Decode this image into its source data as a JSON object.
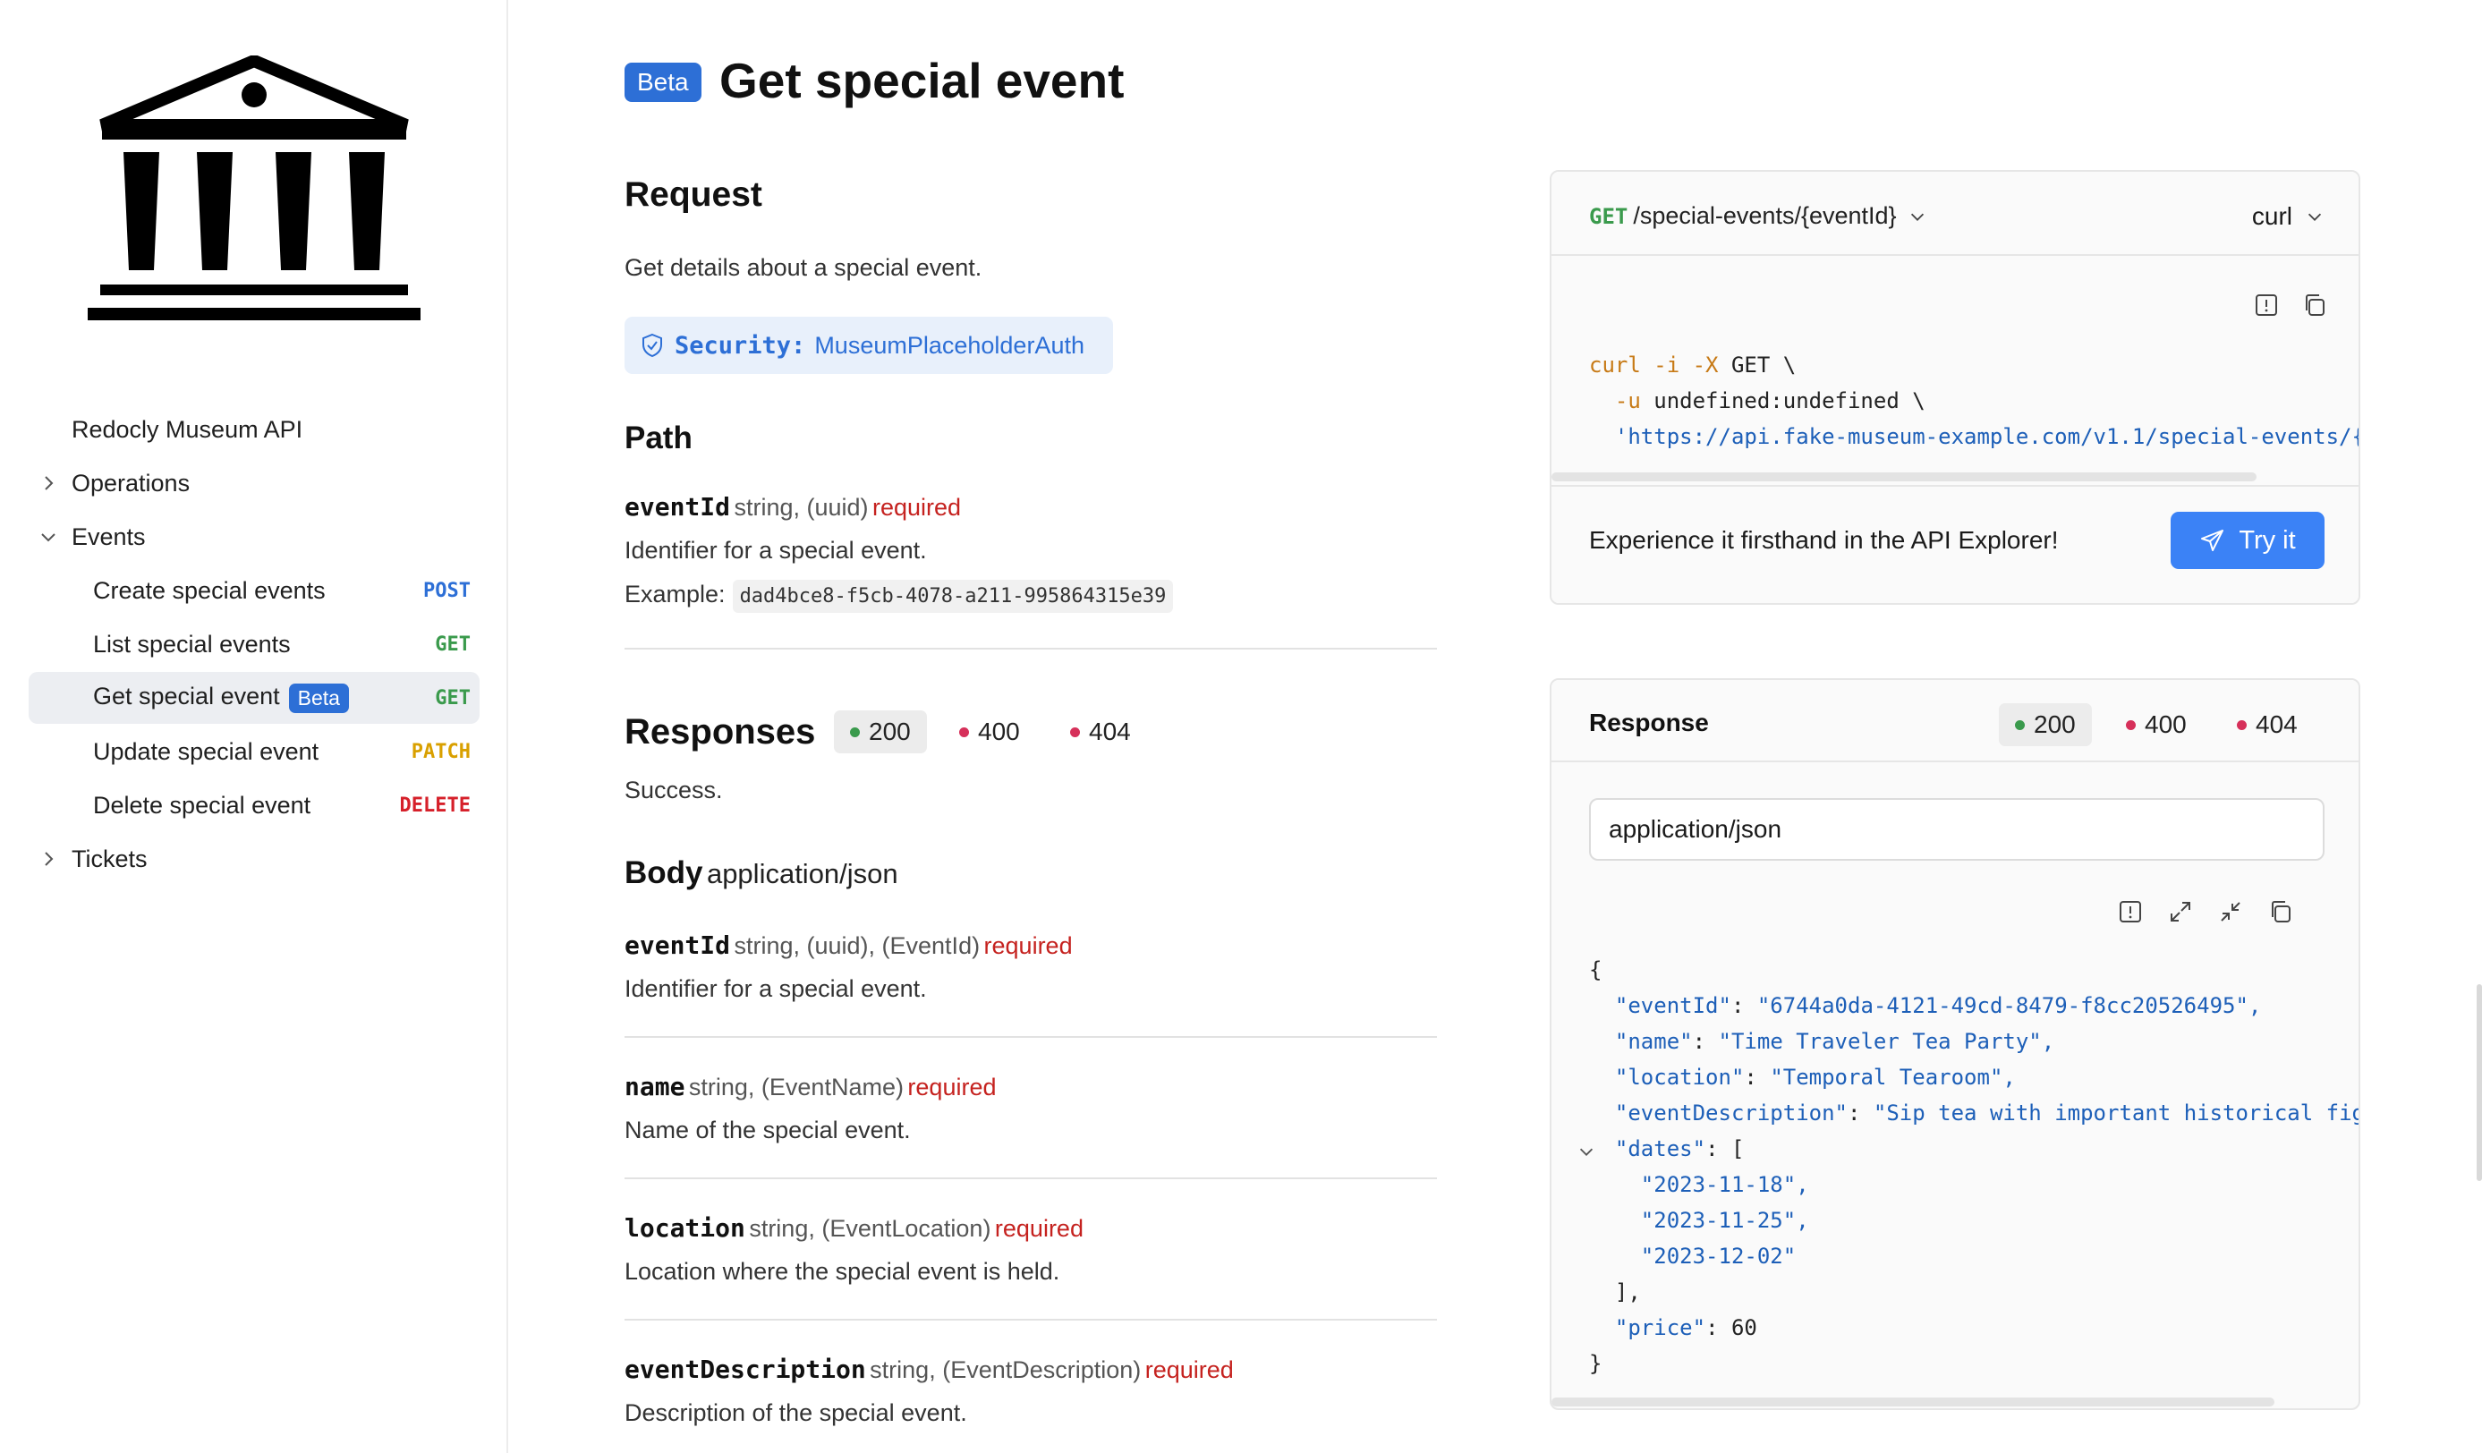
{
  "sidebar": {
    "api_title": "Redocly Museum API",
    "groups": [
      {
        "label": "Operations"
      },
      {
        "label": "Events"
      },
      {
        "label": "Tickets"
      }
    ],
    "events_items": [
      {
        "label": "Create special events",
        "method": "POST",
        "method_color": "#2d6fd6"
      },
      {
        "label": "List special events",
        "method": "GET",
        "method_color": "#3a9a4c"
      },
      {
        "label": "Get special event",
        "badge": "Beta",
        "method": "GET",
        "method_color": "#3a9a4c"
      },
      {
        "label": "Update special event",
        "method": "PATCH",
        "method_color": "#d9a000"
      },
      {
        "label": "Delete special event",
        "method": "DELETE",
        "method_color": "#d6202a"
      }
    ]
  },
  "page": {
    "badge": "Beta",
    "title": "Get special event"
  },
  "request": {
    "heading": "Request",
    "description": "Get details about a special event.",
    "security_label": "Security:",
    "security_value": "MuseumPlaceholderAuth",
    "path_heading": "Path",
    "param": {
      "name": "eventId",
      "type": "string, (uuid)",
      "required": "required",
      "description": "Identifier for a special event.",
      "example_label": "Example:",
      "example_value": "dad4bce8-f5cb-4078-a211-995864315e39"
    }
  },
  "responses": {
    "heading": "Responses",
    "tabs": [
      {
        "code": "200",
        "color": "#3a9a4c"
      },
      {
        "code": "400",
        "color": "#d6305a"
      },
      {
        "code": "404",
        "color": "#d6305a"
      }
    ],
    "success": "Success.",
    "body_heading": "Body",
    "body_type": "application/json",
    "fields": [
      {
        "name": "eventId",
        "type": "string, (uuid), (EventId)",
        "required": "required",
        "description": "Identifier for a special event."
      },
      {
        "name": "name",
        "type": "string, (EventName)",
        "required": "required",
        "description": "Name of the special event."
      },
      {
        "name": "location",
        "type": "string, (EventLocation)",
        "required": "required",
        "description": "Location where the special event is held."
      },
      {
        "name": "eventDescription",
        "type": "string, (EventDescription)",
        "required": "required",
        "description": "Description of the special event."
      }
    ]
  },
  "request_panel": {
    "method": "GET",
    "path": "/special-events/{eventId}",
    "language": "curl",
    "code": {
      "l1_cmd": "curl",
      "l1_flags": " -i -X",
      "l1_rest": " GET \\",
      "l2_flag": "  -u",
      "l2_rest": " undefined:undefined \\",
      "l3_url": "  'https://api.fake-museum-example.com/v1.1/special-events/{"
    },
    "explorer_text": "Experience it firsthand in the API Explorer!",
    "try_label": "Try it"
  },
  "response_panel": {
    "heading": "Response",
    "tabs": [
      {
        "code": "200",
        "color": "#3a9a4c"
      },
      {
        "code": "400",
        "color": "#d6305a"
      },
      {
        "code": "404",
        "color": "#d6305a"
      }
    ],
    "content_type": "application/json",
    "json": {
      "open": "{",
      "eventId_key": "\"eventId\"",
      "eventId_val": "\"6744a0da-4121-49cd-8479-f8cc20526495\",",
      "name_key": "\"name\"",
      "name_val": "\"Time Traveler Tea Party\",",
      "location_key": "\"location\"",
      "location_val": "\"Temporal Tearoom\",",
      "desc_key": "\"eventDescription\"",
      "desc_val": "\"Sip tea with important historical fig",
      "dates_key": "\"dates\"",
      "dates_open": ": [",
      "date1": "\"2023-11-18\",",
      "date2": "\"2023-11-25\",",
      "date3": "\"2023-12-02\"",
      "dates_close": "],",
      "price_key": "\"price\"",
      "price_val": ": 60",
      "close": "}"
    }
  }
}
